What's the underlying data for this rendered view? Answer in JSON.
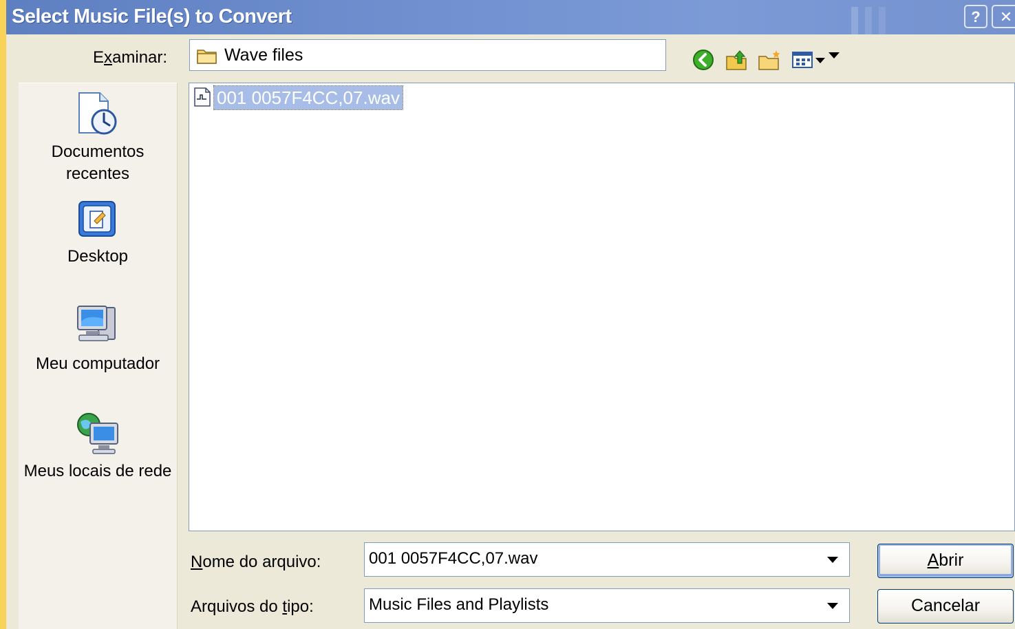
{
  "window": {
    "title": "Select Music File(s) to Convert"
  },
  "lookin": {
    "label_pre": "E",
    "label_u": "x",
    "label_post": "aminar:",
    "value": "Wave files"
  },
  "toolbar": {
    "icons": [
      "back-icon",
      "up-folder-icon",
      "new-folder-icon",
      "view-menu-icon"
    ]
  },
  "places": [
    {
      "label": "Documentos recentes",
      "icon": "recent-documents-icon"
    },
    {
      "label": "Desktop",
      "icon": "desktop-icon"
    },
    {
      "label": "Meu computador",
      "icon": "my-computer-icon"
    },
    {
      "label": "Meus locais de rede",
      "icon": "network-places-icon"
    }
  ],
  "files": [
    {
      "name": "001 0057F4CC,07.wav",
      "selected": true
    }
  ],
  "filename": {
    "label_u": "N",
    "label_rest": "ome do arquivo:",
    "value": "001 0057F4CC,07.wav"
  },
  "filetype": {
    "label_pre": "Arquivos do ",
    "label_u": "t",
    "label_post": "ipo:",
    "value": "Music Files and Playlists"
  },
  "buttons": {
    "open_u": "A",
    "open_rest": "brir",
    "cancel": "Cancelar"
  },
  "colors": {
    "title_bar": "#6f8fcf",
    "selection": "#a7bde8",
    "background": "#ece9d8"
  }
}
